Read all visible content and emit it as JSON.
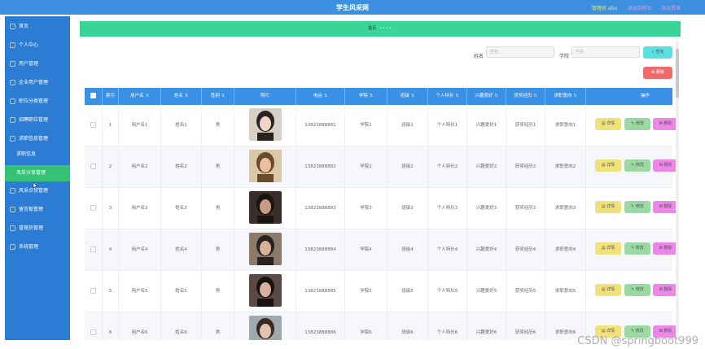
{
  "header": {
    "title": "学生风采网",
    "user_label": "管理员 abo",
    "link_back": "退出到前台",
    "link_logout": "退出登录"
  },
  "sidebar": {
    "items": [
      {
        "label": "首页"
      },
      {
        "label": "个人中心"
      },
      {
        "label": "用户管理"
      },
      {
        "label": "企业用户管理"
      },
      {
        "label": "职位分类管理"
      },
      {
        "label": "招聘职位管理"
      },
      {
        "label": "求职信息管理"
      }
    ],
    "sub_items": [
      {
        "label": "求职信息"
      },
      {
        "label": "风采分享管理"
      }
    ],
    "items_after": [
      {
        "label": "风采点赞管理"
      },
      {
        "label": "留言板管理"
      },
      {
        "label": "管理员管理"
      },
      {
        "label": "系统管理"
      }
    ]
  },
  "banner": {
    "text": "首页",
    "dots": "••••"
  },
  "search": {
    "name_label": "姓名",
    "name_placeholder": "姓名",
    "school_label": "学院",
    "school_placeholder": "学院",
    "query_button": "查询",
    "delete_button": "删除"
  },
  "table": {
    "columns": [
      "索引",
      "用户名",
      "姓名",
      "性别",
      "照片",
      "电话",
      "学院",
      "班级",
      "个人特长",
      "兴趣爱好",
      "获奖经历",
      "求职意向",
      "操作"
    ],
    "rows": [
      {
        "idx": "1",
        "username": "用户名1",
        "name": "姓名1",
        "gender": "男",
        "phone": "13823888881",
        "school": "学院1",
        "class": "班级1",
        "talent": "个人特长1",
        "hobby": "兴趣爱好1",
        "award": "获奖经历1",
        "intent": "求职意向1"
      },
      {
        "idx": "2",
        "username": "用户名2",
        "name": "姓名2",
        "gender": "男",
        "phone": "13823888882",
        "school": "学院2",
        "class": "班级2",
        "talent": "个人特长2",
        "hobby": "兴趣爱好2",
        "award": "获奖经历2",
        "intent": "求职意向2"
      },
      {
        "idx": "3",
        "username": "用户名3",
        "name": "姓名3",
        "gender": "男",
        "phone": "13823888883",
        "school": "学院3",
        "class": "班级3",
        "talent": "个人特长3",
        "hobby": "兴趣爱好3",
        "award": "获奖经历3",
        "intent": "求职意向3"
      },
      {
        "idx": "4",
        "username": "用户名4",
        "name": "姓名4",
        "gender": "男",
        "phone": "13823888884",
        "school": "学院4",
        "class": "班级4",
        "talent": "个人特长4",
        "hobby": "兴趣爱好4",
        "award": "获奖经历4",
        "intent": "求职意向4"
      },
      {
        "idx": "5",
        "username": "用户名5",
        "name": "姓名5",
        "gender": "男",
        "phone": "13823888885",
        "school": "学院5",
        "class": "班级5",
        "talent": "个人特长5",
        "hobby": "兴趣爱好5",
        "award": "获奖经历5",
        "intent": "求职意向5"
      },
      {
        "idx": "6",
        "username": "用户名6",
        "name": "姓名6",
        "gender": "男",
        "phone": "13823888886",
        "school": "学院6",
        "class": "班级6",
        "talent": "个人特长6",
        "hobby": "兴趣爱好6",
        "award": "获奖经历6",
        "intent": "求职意向6"
      }
    ],
    "actions": {
      "detail": "详情",
      "edit": "修改",
      "delete": "删除"
    }
  },
  "watermark": "CSDN @springboot999",
  "colors": {
    "topbar": "#3d8fe0",
    "sidebar": "#2b7cd3",
    "active": "#35c277",
    "banner": "#39d497",
    "thead": "#3a90e5",
    "detail": "#f1e17a",
    "edit": "#9ad9a2",
    "delete": "#ec86e8",
    "query": "#59e0e3",
    "delete_top": "#f06a6a"
  }
}
